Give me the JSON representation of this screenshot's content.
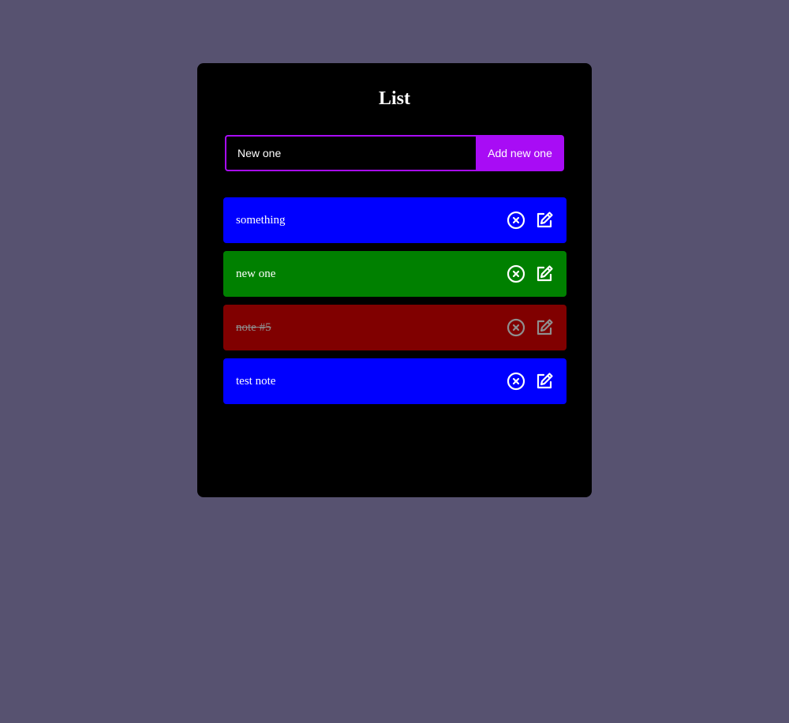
{
  "page": {
    "title": "List"
  },
  "form": {
    "input_value": "New one",
    "add_button_label": "Add new one"
  },
  "notes": [
    {
      "text": "something",
      "color": "#0000ff",
      "done": false
    },
    {
      "text": "new one",
      "color": "#008000",
      "done": false
    },
    {
      "text": "note #5",
      "color": "#800000",
      "done": true
    },
    {
      "text": "test note",
      "color": "#0000ff",
      "done": false
    }
  ],
  "colors": {
    "background": "#575270",
    "panel": "#000000",
    "accent": "#a80cf5"
  },
  "icons": {
    "delete": "circle-x-icon",
    "edit": "edit-icon"
  }
}
